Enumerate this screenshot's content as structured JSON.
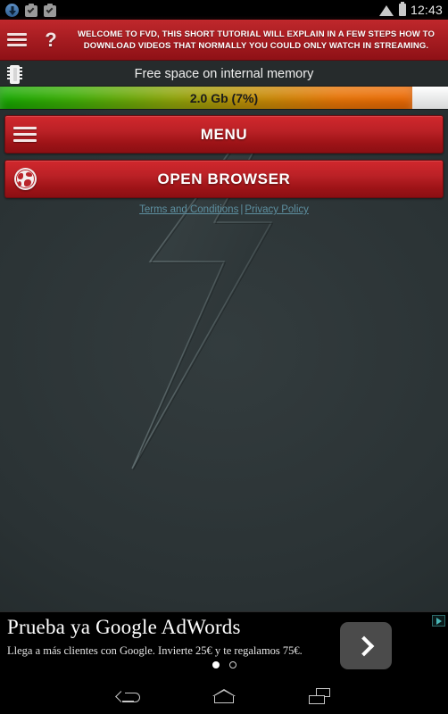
{
  "statusbar": {
    "time": "12:43",
    "icons": [
      "download-icon",
      "clipboard-check-icon",
      "clipboard-check-icon",
      "wifi-icon",
      "battery-icon"
    ]
  },
  "header": {
    "menu_icon": "hamburger-icon",
    "help_icon": "question-mark-icon",
    "banner_text": "WELCOME TO FVD, THIS SHORT TUTORIAL WILL EXPLAIN IN A FEW STEPS HOW TO DOWNLOAD VIDEOS THAT NORMALLY YOU COULD ONLY WATCH IN STREAMING.",
    "accent_color": "#b9252a"
  },
  "memory": {
    "icon": "memory-chip-icon",
    "title": "Free space on internal memory",
    "bar_label": "2.0 Gb (7%)",
    "fill_percent": 92,
    "free_value": "2.0 Gb",
    "free_percent": "7%",
    "gradient_start": "#16a800",
    "gradient_end": "#ec6a05"
  },
  "buttons": {
    "menu": {
      "label": "MENU",
      "icon": "hamburger-icon"
    },
    "browser": {
      "label": "OPEN BROWSER",
      "icon": "globe-icon"
    }
  },
  "links": {
    "terms": "Terms and Conditions",
    "separator": "|",
    "privacy": "Privacy Policy",
    "color": "#5d8fa0"
  },
  "logo": {
    "name": "lightning-bolt-logo",
    "background_color": "#2a3234"
  },
  "ad": {
    "headline": "Prueba ya Google AdWords",
    "subtext": "Llega a más clientes con Google. Invierte 25€ y te regalamos 75€.",
    "cta_icon": "chevron-right-icon",
    "adchoices_icon": "adchoices-icon",
    "dots": 2,
    "active_dot": 0
  },
  "navbar": {
    "back": "back-button",
    "home": "home-button",
    "recents": "recents-button"
  }
}
